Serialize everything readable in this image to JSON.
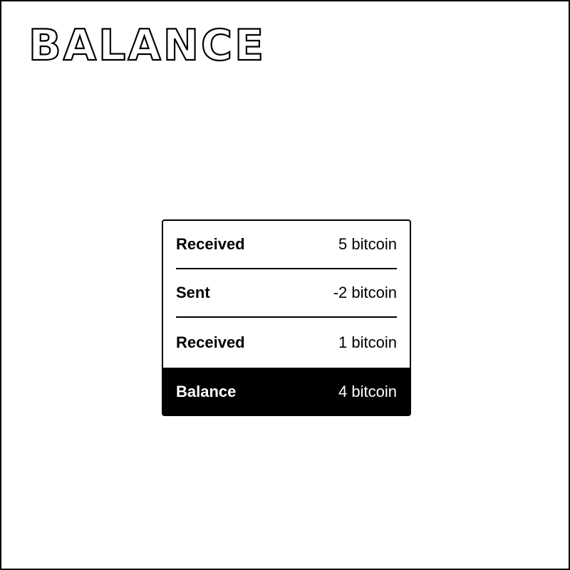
{
  "title": "BALANCE",
  "ledger": {
    "rows": [
      {
        "label": "Received",
        "amount": "5 bitcoin"
      },
      {
        "label": "Sent",
        "amount": "-2 bitcoin"
      },
      {
        "label": "Received",
        "amount": "1 bitcoin"
      }
    ],
    "total": {
      "label": "Balance",
      "amount": "4 bitcoin"
    }
  },
  "colors": {
    "ink": "#000000",
    "paper": "#ffffff"
  }
}
